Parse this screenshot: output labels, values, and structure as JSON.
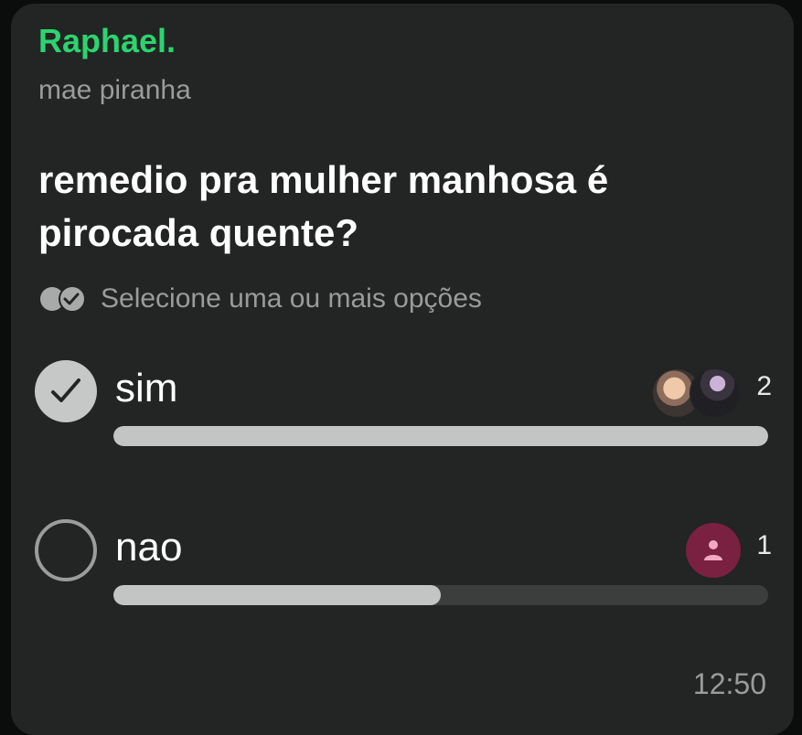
{
  "message": {
    "sender": "Raphael.",
    "subtitle": "mae piranha",
    "question": "remedio pra mulher manhosa é pirocada quente?",
    "hint": "Selecione uma ou mais opções",
    "timestamp": "12:50"
  },
  "poll": {
    "options": [
      {
        "label": "sim",
        "count": "2",
        "selected": true,
        "progress": 1.0
      },
      {
        "label": "nao",
        "count": "1",
        "selected": false,
        "progress": 0.5
      }
    ]
  },
  "colors": {
    "sender": "#2bd46f",
    "bubble": "#232424",
    "bar_fill": "#c3c4c4",
    "bar_track": "#3c3d3d",
    "avatar_placeholder": "#7a2040"
  },
  "icons": {
    "hint": "double-check-circles-icon",
    "selected": "check-circle-icon",
    "unselected": "empty-circle-icon",
    "placeholder_avatar": "person-icon"
  }
}
